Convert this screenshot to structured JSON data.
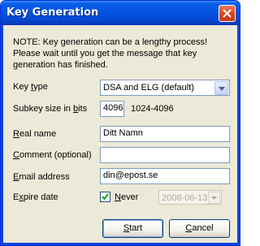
{
  "window": {
    "title": "Key Generation"
  },
  "note": {
    "lines": [
      "NOTE: Key generation can be a lengthy process!",
      "Please wait until you get the message that key",
      "generation has finished."
    ]
  },
  "form": {
    "key_type": {
      "label_pre": "Key ",
      "label_accel": "t",
      "label_post": "ype",
      "value": "DSA and ELG (default)"
    },
    "subkey_size": {
      "label_pre": "Subkey size in ",
      "label_accel": "b",
      "label_post": "its",
      "value": "4096",
      "range": "1024-4096"
    },
    "real_name": {
      "label_pre": "",
      "label_accel": "R",
      "label_post": "eal name",
      "value": "Ditt Namn"
    },
    "comment": {
      "label_pre": "",
      "label_accel": "C",
      "label_post": "omment (optional)",
      "value": ""
    },
    "email": {
      "label_pre": "",
      "label_accel": "E",
      "label_post": "mail address",
      "value": "din@epost.se"
    },
    "expire": {
      "label_pre": "E",
      "label_accel": "x",
      "label_post": "pire date",
      "never_pre": "",
      "never_accel": "N",
      "never_post": "ever",
      "never_checked": true,
      "date_value": "2008-06-13"
    }
  },
  "buttons": {
    "start": {
      "pre": "",
      "accel": "S",
      "post": "tart"
    },
    "cancel": {
      "pre": "",
      "accel": "C",
      "post": "ancel"
    }
  }
}
